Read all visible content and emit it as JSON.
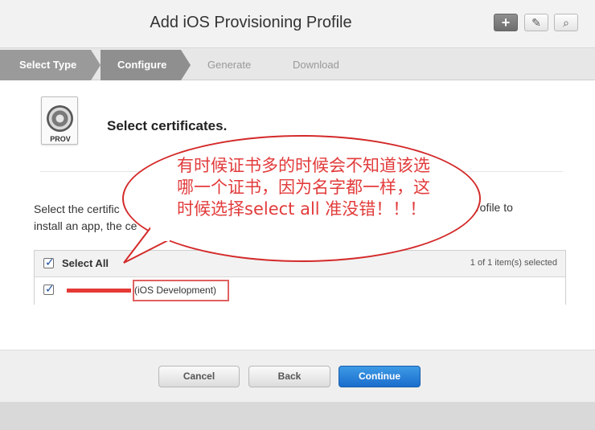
{
  "header": {
    "title": "Add iOS Provisioning Profile",
    "plus_label": "+",
    "edit_label": "✎",
    "search_label": "⌕"
  },
  "steps": [
    {
      "label": "Select Type",
      "state": "done"
    },
    {
      "label": "Configure",
      "state": "current"
    },
    {
      "label": "Generate",
      "state": "future"
    },
    {
      "label": "Download",
      "state": "future"
    }
  ],
  "main": {
    "icon_label": "PROV",
    "section_title": "Select certificates.",
    "description_line1": "Select the certific",
    "description_line2": "install an app, the ce",
    "description_right": "rofile to"
  },
  "table": {
    "select_all_label": "Select All",
    "selected_count": "1 of 1 item(s) selected",
    "rows": [
      {
        "name_redacted": true,
        "type": "(iOS Development)",
        "checked": true
      }
    ]
  },
  "annotation": {
    "text": "有时候证书多的时候会不知道该选哪一个证书，因为名字都一样，这时候选择select all 准没错！！！"
  },
  "footer": {
    "cancel_label": "Cancel",
    "back_label": "Back",
    "continue_label": "Continue"
  },
  "colors": {
    "accent_blue": "#1a6dcc",
    "annotation_red": "#d42a2a",
    "redaction_red": "#e53935"
  }
}
